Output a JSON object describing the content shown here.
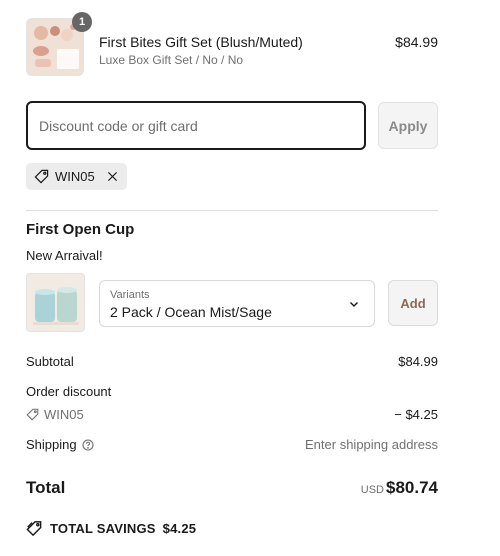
{
  "cart": {
    "items": [
      {
        "name": "First Bites Gift Set (Blush/Muted)",
        "variant": "Luxe Box Gift Set / No / No",
        "price": "$84.99",
        "quantity": "1",
        "thumbnail_icon": "gift-set-product-image"
      }
    ]
  },
  "discount": {
    "placeholder": "Discount code or gift card",
    "value": "",
    "apply_label": "Apply",
    "applied_code": "WIN05"
  },
  "upsell": {
    "title": "First Open Cup",
    "subtitle": "New Arraival!",
    "thumbnail_icon": "cups-product-image",
    "variant_label": "Variants",
    "variant_value": "2 Pack / Ocean Mist/Sage",
    "add_label": "Add"
  },
  "summary": {
    "subtotal_label": "Subtotal",
    "subtotal_value": "$84.99",
    "order_discount_label": "Order discount",
    "discount_code": "WIN05",
    "discount_value": "− $4.25",
    "shipping_label": "Shipping",
    "shipping_value": "Enter shipping address",
    "total_label": "Total",
    "currency": "USD",
    "total_value": "$80.74",
    "savings_label": "TOTAL SAVINGS",
    "savings_value": "$4.25"
  },
  "colors": {
    "accent_add": "#8b6a55",
    "badge": "#666666",
    "chip_bg": "#ececec"
  }
}
